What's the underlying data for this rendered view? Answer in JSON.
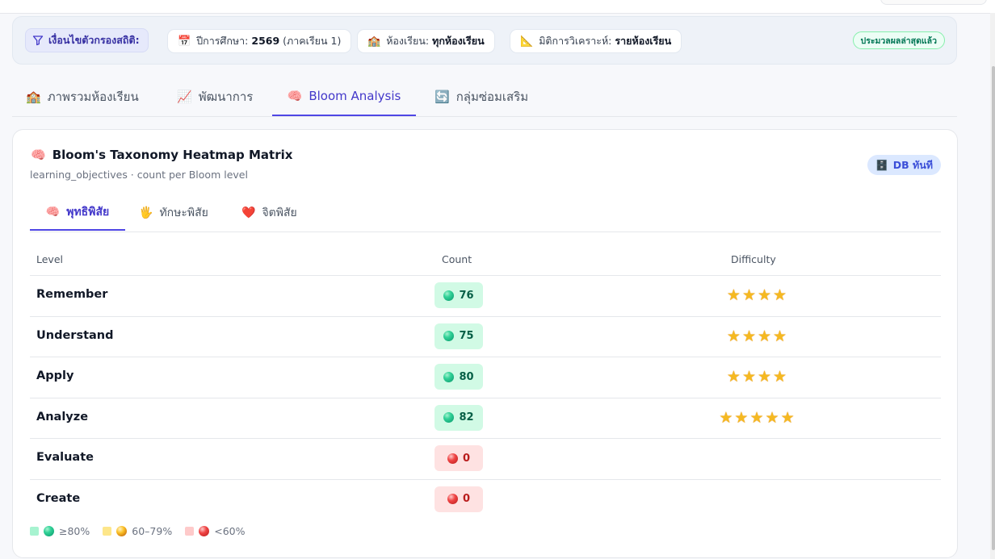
{
  "filters": {
    "label": "เงื่อนไขตัวกรองสถิติ:",
    "year": {
      "label": "ปีการศึกษา:",
      "value": "2569",
      "suffix": "(ภาคเรียน 1)"
    },
    "classroom": {
      "label": "ห้องเรียน:",
      "value": "ทุกห้องเรียน"
    },
    "dimension": {
      "label": "มิติการวิเคราะห์:",
      "value": "รายห้องเรียน"
    },
    "status": "ประมวลผลล่าสุดแล้ว"
  },
  "main_tabs": [
    {
      "icon": "🏫",
      "label": "ภาพรวมห้องเรียน"
    },
    {
      "icon": "📈",
      "label": "พัฒนาการ"
    },
    {
      "icon": "🧠",
      "label": "Bloom Analysis"
    },
    {
      "icon": "🔄",
      "label": "กลุ่มซ่อมเสริม"
    }
  ],
  "card": {
    "icon": "🧠",
    "title": "Bloom's Taxonomy Heatmap Matrix",
    "subtitle": "learning_objectives · count per Bloom level",
    "badge_icon": "🗄️",
    "badge": "DB ทันที"
  },
  "sub_tabs": [
    {
      "icon": "🧠",
      "label": "พุทธิพิสัย"
    },
    {
      "icon": "🖐",
      "label": "ทักษะพิสัย"
    },
    {
      "icon": "❤️",
      "label": "จิตพิสัย"
    }
  ],
  "table": {
    "headers": {
      "level": "Level",
      "count": "Count",
      "difficulty": "Difficulty"
    },
    "rows": [
      {
        "level": "Remember",
        "count": "76",
        "band": "high",
        "stars": 4
      },
      {
        "level": "Understand",
        "count": "75",
        "band": "high",
        "stars": 4
      },
      {
        "level": "Apply",
        "count": "80",
        "band": "high",
        "stars": 4
      },
      {
        "level": "Analyze",
        "count": "82",
        "band": "high",
        "stars": 5
      },
      {
        "level": "Evaluate",
        "count": "0",
        "band": "low",
        "stars": 0
      },
      {
        "level": "Create",
        "count": "0",
        "band": "low",
        "stars": 0
      }
    ]
  },
  "legend": [
    {
      "label": "≥80%",
      "square": "#a7f3d0",
      "ball": "g"
    },
    {
      "label": "60–79%",
      "square": "#fde68a",
      "ball": "y"
    },
    {
      "label": "<60%",
      "square": "#fecaca",
      "ball": "r"
    }
  ],
  "colors": {
    "accent": "#4f46e5",
    "high": "#d1fae5",
    "low": "#fee2e2",
    "star": "#f5b921"
  }
}
